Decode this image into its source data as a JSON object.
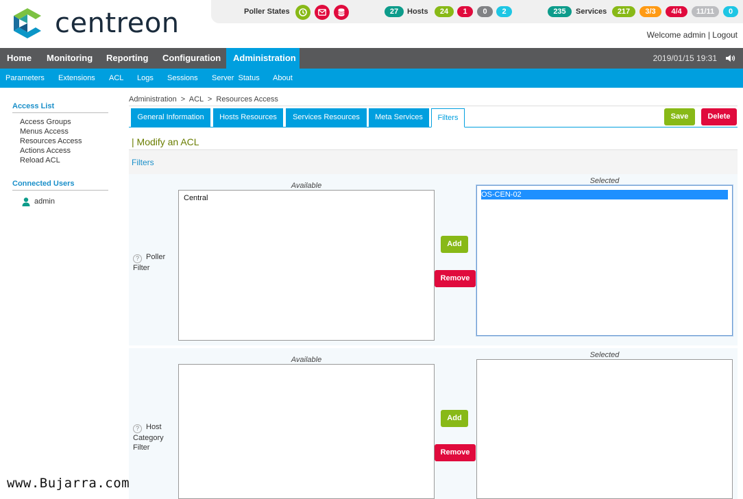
{
  "header": {
    "logo_text": "centreon",
    "poller_states_label": "Poller States",
    "hosts_label": "Hosts",
    "services_label": "Services",
    "hosts_total": "27",
    "hosts_up": "24",
    "hosts_down": "1",
    "hosts_unreachable": "0",
    "hosts_pending": "2",
    "services_total": "235",
    "services_ok": "217",
    "services_warning": "3/3",
    "services_critical": "4/4",
    "services_unknown": "11/11",
    "services_pending": "0",
    "welcome": "Welcome admin",
    "separator": "|",
    "logout": "Logout",
    "icons": [
      "clock-icon",
      "mail-icon",
      "database-icon"
    ]
  },
  "main_nav": {
    "items": [
      "Home",
      "Monitoring",
      "Reporting",
      "Configuration",
      "Administration"
    ],
    "active": "Administration",
    "datetime": "2019/01/15 19:31"
  },
  "sub_nav": {
    "items": [
      "Parameters",
      "Extensions",
      "ACL",
      "Logs",
      "Sessions",
      "Server  Status",
      "About"
    ]
  },
  "sidebar": {
    "access_list_title": "Access List",
    "access_items": [
      "Access Groups",
      "Menus Access",
      "Resources Access",
      "Actions Access",
      "Reload ACL"
    ],
    "connected_users_title": "Connected Users",
    "user": "admin"
  },
  "breadcrumb": "Administration  >  ACL  >  Resources Access",
  "tabs": [
    "General Information",
    "Hosts Resources",
    "Services Resources",
    "Meta Services",
    "Filters"
  ],
  "active_tab": "Filters",
  "buttons": {
    "save": "Save",
    "delete": "Delete",
    "add": "Add",
    "remove": "Remove"
  },
  "page_title": "| Modify an ACL",
  "section_title": "Filters",
  "poller_filter": {
    "label": "Poller Filter",
    "available_caption": "Available",
    "selected_caption": "Selected",
    "available": [
      "Central"
    ],
    "selected": [
      "OS-CEN-02"
    ]
  },
  "host_category_filter": {
    "label": "Host Category Filter",
    "available_caption": "Available",
    "selected_caption": "Selected",
    "available": [],
    "selected": []
  },
  "watermark": "www.Bujarra.com",
  "colors": {
    "brand_blue": "#009fdf",
    "nav_gray": "#58595b",
    "ok_green": "#88b917",
    "critical_red": "#e00b3d",
    "warning_orange": "#ff9a13",
    "total_teal": "#0d9c8b",
    "pending_cyan": "#1ec6e4",
    "unknown_gray": "#bcbdc0"
  }
}
